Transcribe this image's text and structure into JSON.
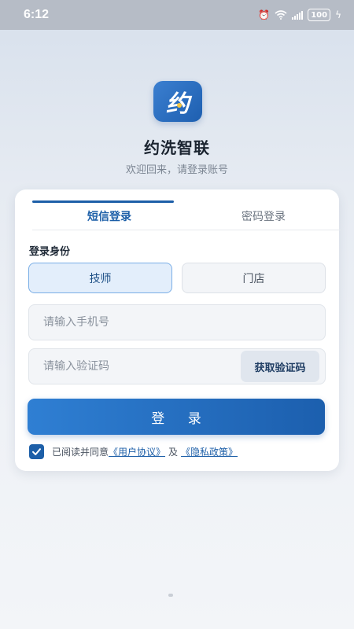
{
  "status_bar": {
    "time": "6:12",
    "battery": "100",
    "icons": [
      "alarm-icon",
      "wifi-icon",
      "signal-icon",
      "battery-icon",
      "charging-icon"
    ]
  },
  "app": {
    "logo_char": "约",
    "name": "约洗智联",
    "welcome": "欢迎回来，请登录账号"
  },
  "tabs": [
    {
      "label": "短信登录",
      "active": true
    },
    {
      "label": "密码登录",
      "active": false
    }
  ],
  "identity": {
    "label": "登录身份",
    "options": [
      {
        "label": "技师",
        "selected": true
      },
      {
        "label": "门店",
        "selected": false
      }
    ]
  },
  "form": {
    "phone_placeholder": "请输入手机号",
    "code_placeholder": "请输入验证码",
    "get_code_label": "获取验证码",
    "login_label": "登 录"
  },
  "agreement": {
    "checked": true,
    "prefix": "已阅读并同意",
    "user_agreement": "《用户协议》",
    "and": "及",
    "privacy_policy": "《隐私政策》"
  },
  "colors": {
    "accent": "#1d5fa8",
    "login_gradient_start": "#2f7fd3",
    "login_gradient_end": "#1c5fae",
    "status_bar": "#b6bcc6"
  }
}
